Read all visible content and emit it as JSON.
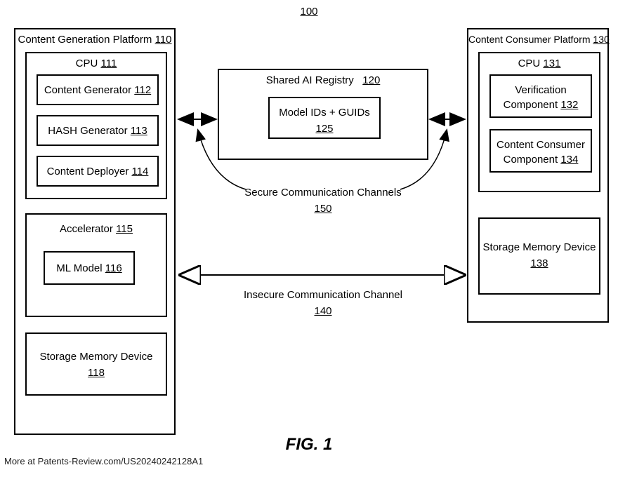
{
  "figure_ref": "100",
  "figure_label": "FIG. 1",
  "footer": "More at Patents-Review.com/US20240242128A1",
  "gen_platform": {
    "title": "Content Generation Platform",
    "ref": "110"
  },
  "gen_cpu": {
    "title": "CPU",
    "ref": "111"
  },
  "content_generator": {
    "title": "Content Generator",
    "ref": "112"
  },
  "hash_generator": {
    "title": "HASH Generator",
    "ref": "113"
  },
  "content_deployer": {
    "title": "Content Deployer",
    "ref": "114"
  },
  "accelerator": {
    "title": "Accelerator",
    "ref": "115"
  },
  "ml_model": {
    "title": "ML Model",
    "ref": "116"
  },
  "gen_storage": {
    "title": "Storage Memory Device",
    "ref": "118"
  },
  "registry": {
    "title": "Shared AI Registry",
    "ref": "120"
  },
  "registry_inner": {
    "title": "Model IDs + GUIDs",
    "ref": "125"
  },
  "consumer_platform": {
    "title": "Content Consumer Platform",
    "ref": "130"
  },
  "consumer_cpu": {
    "title": "CPU",
    "ref": "131"
  },
  "verification": {
    "title": "Verification Component",
    "ref": "132"
  },
  "content_consumer": {
    "title": "Content Consumer Component",
    "ref": "134"
  },
  "consumer_storage": {
    "title": "Storage Memory Device",
    "ref": "138"
  },
  "secure_channels": {
    "title": "Secure Communication Channels",
    "ref": "150"
  },
  "insecure_channel": {
    "title": "Insecure Communication Channel",
    "ref": "140"
  }
}
